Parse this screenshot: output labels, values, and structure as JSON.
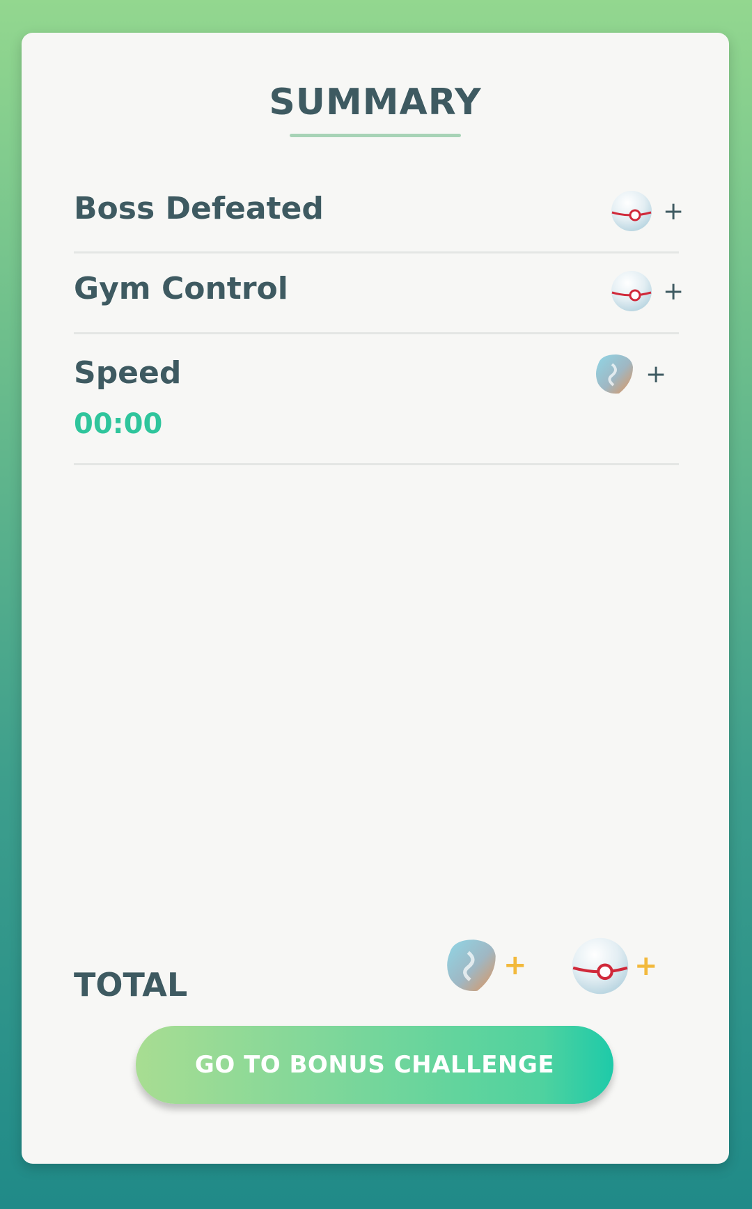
{
  "summary": {
    "title": "SUMMARY"
  },
  "rows": [
    {
      "label": "Boss Defeated",
      "reward_icon": "premier-ball-icon",
      "reward_suffix": "+"
    },
    {
      "label": "Gym Control",
      "reward_icon": "premier-ball-icon",
      "reward_suffix": "+"
    },
    {
      "label": "Speed",
      "value": "00:00",
      "reward_icon": "rare-candy-icon",
      "reward_suffix": "+"
    }
  ],
  "total": {
    "label": "TOTAL",
    "rewards": [
      {
        "icon": "rare-candy-icon",
        "suffix": "+"
      },
      {
        "icon": "premier-ball-icon",
        "suffix": "+"
      }
    ]
  },
  "button": {
    "label": "GO TO BONUS CHALLENGE"
  },
  "colors": {
    "background_top": "#93d78f",
    "background_bottom": "#208a88",
    "card": "#f7f7f5",
    "text": "#3e5a61",
    "timer": "#2fc59c",
    "plus_gold": "#f2b93c",
    "button_start": "#a8dd92",
    "button_end": "#1ecaa9"
  }
}
